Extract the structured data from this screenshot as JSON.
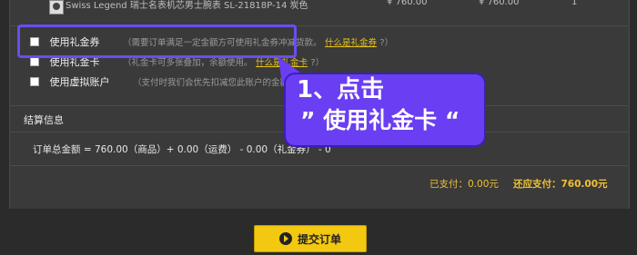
{
  "product": {
    "name": "Swiss Legend 瑞士名表机芯男士腕表 SL-21818P-14 炭色",
    "price": "¥ 760.00",
    "subtotal": "¥ 760.00",
    "quantity": "1"
  },
  "options": [
    {
      "label": "使用礼金券",
      "hint": "（需要订单满足一定金额方可使用礼金券冲减货款。",
      "link": "什么是礼金券",
      "hint_end": "?）"
    },
    {
      "label": "使用礼金卡",
      "hint": "（礼金卡可多张叠加，余额使用。",
      "link": "什么是礼金卡",
      "hint_end": "?）"
    },
    {
      "label": "使用虚拟账户",
      "hint": "（支付时我们会优先扣减您此账户的金额。",
      "link": "什么",
      "hint_end": ""
    }
  ],
  "callout": {
    "line1": "1、点击",
    "line2": "” 使用礼金卡 “"
  },
  "settlement": {
    "title": "结算信息",
    "summary": "订单总金额 = 760.00（商品）+ 0.00（运费） - 0.00（礼金券） - 0",
    "paid": "已支付：0.00元",
    "due": "还应支付：760.00元"
  },
  "actions": {
    "submit_label": "提交订单"
  },
  "colors": {
    "accent": "#f2c811",
    "highlight": "#6b4df0",
    "callout_bg": "#6a3ef2"
  }
}
